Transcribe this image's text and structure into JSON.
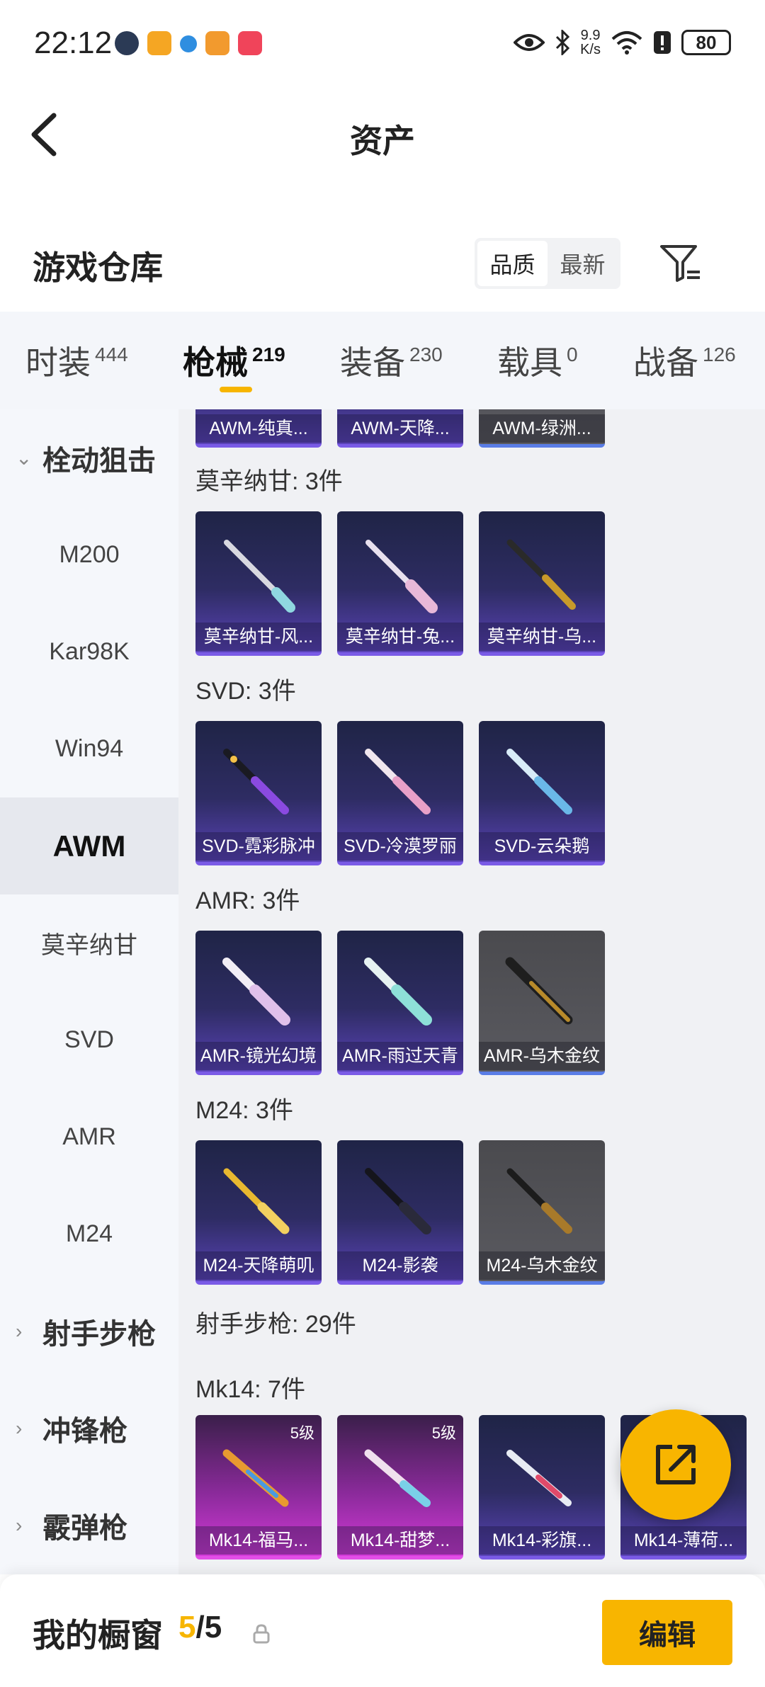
{
  "status_bar": {
    "time": "22:12",
    "net_speed_top": "9.9",
    "net_speed_bottom": "K/s",
    "battery": "80"
  },
  "header": {
    "title": "资产"
  },
  "warehouse": {
    "title": "游戏仓库",
    "sort_options": [
      "品质",
      "最新"
    ],
    "active_sort": "品质"
  },
  "tabs": [
    {
      "label": "时装",
      "count": "444"
    },
    {
      "label": "枪械",
      "count": "219"
    },
    {
      "label": "装备",
      "count": "230"
    },
    {
      "label": "载具",
      "count": "0"
    },
    {
      "label": "战备",
      "count": "126"
    }
  ],
  "active_tab": "枪械",
  "sidebar": {
    "group_bolt": "栓动狙击",
    "items": [
      "M200",
      "Kar98K",
      "Win94",
      "AWM",
      "莫辛纳甘",
      "SVD",
      "AMR",
      "M24"
    ],
    "active_item": "AWM",
    "group_marksman": "射手步枪",
    "group_smg": "冲锋枪",
    "group_shotgun": "霰弹枪"
  },
  "sections": {
    "awm_cards": [
      "AWM-纯真...",
      "AWM-天降...",
      "AWM-绿洲..."
    ],
    "mosin": {
      "title": "莫辛纳甘: 3件",
      "cards": [
        "莫辛纳甘-风...",
        "莫辛纳甘-兔...",
        "莫辛纳甘-乌..."
      ]
    },
    "svd": {
      "title": "SVD: 3件",
      "cards": [
        "SVD-霓彩脉冲",
        "SVD-冷漠罗丽",
        "SVD-云朵鹅"
      ]
    },
    "amr": {
      "title": "AMR: 3件",
      "cards": [
        "AMR-镜光幻境",
        "AMR-雨过天青",
        "AMR-乌木金纹"
      ]
    },
    "m24": {
      "title": "M24: 3件",
      "cards": [
        "M24-天降萌叽",
        "M24-影袭",
        "M24-乌木金纹"
      ]
    },
    "marksman": {
      "title": "射手步枪: 29件"
    },
    "mk14": {
      "title": "Mk14: 7件",
      "cards": [
        "Mk14-福马...",
        "Mk14-甜梦...",
        "Mk14-彩旗...",
        "Mk14-薄荷..."
      ],
      "levels": [
        "5级",
        "5级"
      ]
    }
  },
  "showcase": {
    "title": "我的橱窗",
    "count_current": "5",
    "count_total": "/5",
    "edit_label": "编辑"
  },
  "colors": {
    "accent": "#f8b500",
    "card_purple": "#4a3aa0",
    "card_pink": "#c832d0",
    "card_gray": "#55555a"
  }
}
